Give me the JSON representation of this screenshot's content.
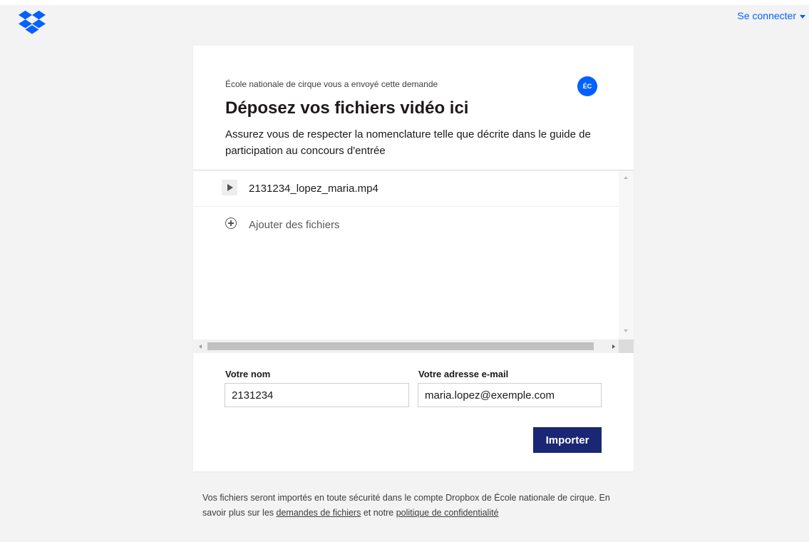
{
  "header": {
    "signin_label": "Se connecter",
    "logo_icon": "dropbox-logo-icon",
    "accent_color": "#0061fe"
  },
  "request": {
    "sender_text": "École nationale de cirque vous a envoyé cette demande",
    "avatar_initials": "ÉC",
    "title": "Déposez vos fichiers vidéo ici",
    "description": "Assurez vous de respecter la nomenclature telle que décrite dans le guide de participation au concours d'entrée"
  },
  "files": {
    "items": [
      {
        "name": "2131234_lopez_maria.mp4",
        "icon": "play-icon"
      }
    ],
    "add_label": "Ajouter des fichiers"
  },
  "form": {
    "name_label": "Votre nom",
    "name_value": "2131234",
    "email_label": "Votre adresse e-mail",
    "email_value": "maria.lopez@exemple.com",
    "submit_label": "Importer",
    "submit_color": "#1a2774"
  },
  "footer": {
    "text_before": "Vos fichiers seront importés en toute sécurité dans le compte Dropbox de École nationale de cirque. En savoir plus sur les ",
    "link_requests": "demandes de fichiers",
    "text_middle": " et notre ",
    "link_privacy": "politique de confidentialité"
  }
}
